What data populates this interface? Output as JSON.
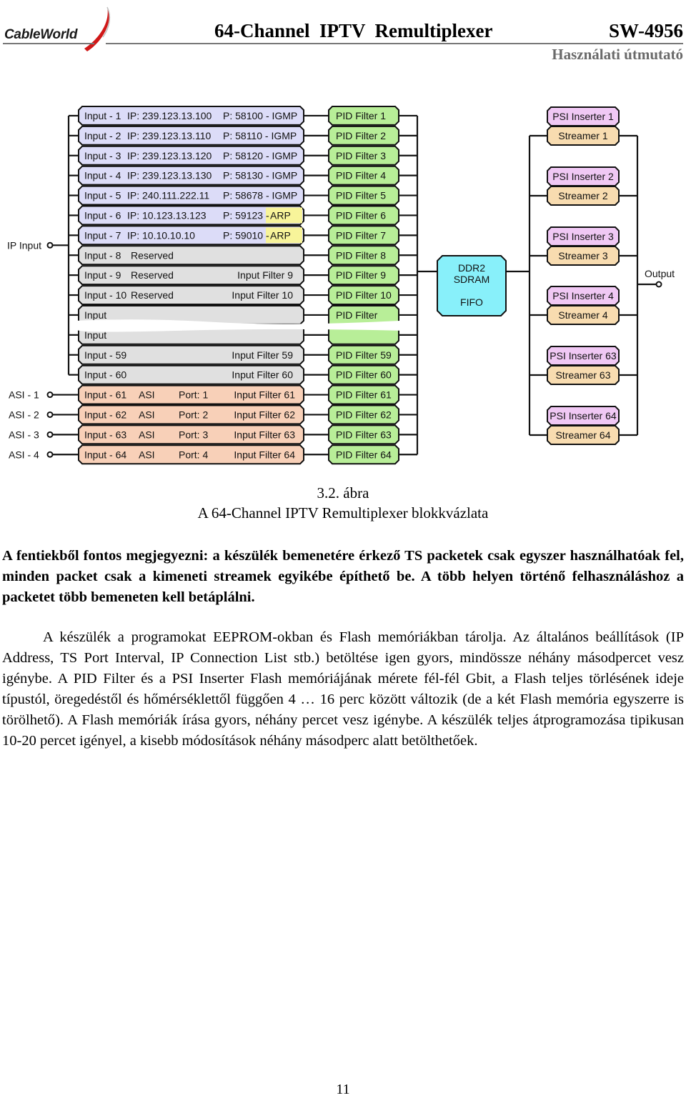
{
  "header": {
    "logo_text": "CableWorld",
    "title": "64-Channel  IPTV  Remultiplexer",
    "model": "SW-4956",
    "subtitle": "Használati útmutató"
  },
  "diagram": {
    "ip_input_label": "IP Input",
    "output_label": "Output",
    "asi_labels": [
      "ASI - 1",
      "ASI - 2",
      "ASI - 3",
      "ASI - 4"
    ],
    "inputs": [
      {
        "name": "Input - 1",
        "ip": "IP: 239.123.13.100",
        "port": "P: 58100 - IGMP",
        "type": "ip"
      },
      {
        "name": "Input - 2",
        "ip": "IP: 239.123.13.110",
        "port": "P: 58110 - IGMP",
        "type": "ip"
      },
      {
        "name": "Input - 3",
        "ip": "IP: 239.123.13.120",
        "port": "P: 58120 - IGMP",
        "type": "ip"
      },
      {
        "name": "Input - 4",
        "ip": "IP: 239.123.13.130",
        "port": "P: 58130 - IGMP",
        "type": "ip"
      },
      {
        "name": "Input - 5",
        "ip": "IP: 240.111.222.11",
        "port": "P: 58678 - IGMP",
        "type": "ip"
      },
      {
        "name": "Input - 6",
        "ip": "IP:  10.123.13.123",
        "port": "P: 59123 - ",
        "arp": "ARP",
        "type": "ip"
      },
      {
        "name": "Input - 7",
        "ip": "IP:  10.10.10.10",
        "port": "P: 59010 - ",
        "arp": "ARP",
        "type": "ip"
      },
      {
        "name": "Input - 8",
        "ip": "Reserved",
        "filter": "",
        "type": "reserved"
      },
      {
        "name": "Input - 9",
        "ip": "Reserved",
        "filter": "Input Filter  9",
        "type": "reserved"
      },
      {
        "name": "Input - 10",
        "ip": "Reserved",
        "filter": "Input Filter 10",
        "type": "reserved"
      },
      {
        "name": "Input",
        "ip": "",
        "filter": "",
        "type": "gap"
      },
      {
        "name": "Input",
        "ip": "",
        "filter": "",
        "type": "gap"
      },
      {
        "name": "Input - 59",
        "ip": "",
        "filter": "Input Filter 59",
        "type": "reserved"
      },
      {
        "name": "Input - 60",
        "ip": "",
        "filter": "Input Filter 60",
        "type": "reserved"
      },
      {
        "name": "Input - 61",
        "ip": "ASI",
        "port": "Port: 1",
        "filter": "Input Filter 61",
        "type": "asi"
      },
      {
        "name": "Input - 62",
        "ip": "ASI",
        "port": "Port: 2",
        "filter": "Input Filter 62",
        "type": "asi"
      },
      {
        "name": "Input - 63",
        "ip": "ASI",
        "port": "Port: 3",
        "filter": "Input Filter 63",
        "type": "asi"
      },
      {
        "name": "Input - 64",
        "ip": "ASI",
        "port": "Port: 4",
        "filter": "Input Filter 64",
        "type": "asi"
      }
    ],
    "pid_filters": [
      "PID Filter 1",
      "PID Filter 2",
      "PID Filter 3",
      "PID Filter 4",
      "PID Filter 5",
      "PID Filter 6",
      "PID Filter 7",
      "PID Filter 8",
      "PID Filter 9",
      "PID Filter 10",
      "PID Filter",
      "",
      "PID Filter 59",
      "PID Filter 60",
      "PID Filter 61",
      "PID Filter 62",
      "PID Filter 63",
      "PID Filter 64"
    ],
    "memory": [
      "DDR2",
      "SDRAM",
      "FIFO"
    ],
    "outputs": [
      {
        "psi": "PSI Inserter 1",
        "streamer": "Streamer 1"
      },
      {
        "psi": "PSI Inserter 2",
        "streamer": "Streamer 2"
      },
      {
        "psi": "PSI Inserter 3",
        "streamer": "Streamer 3"
      },
      {
        "psi": "PSI Inserter 4",
        "streamer": "Streamer 4"
      },
      {
        "psi": "PSI Inserter 63",
        "streamer": "Streamer 63"
      },
      {
        "psi": "PSI Inserter 64",
        "streamer": "Streamer 64"
      }
    ],
    "colors": {
      "ip_input": "#dcdcf8",
      "reserved": "#e0e0e0",
      "asi": "#f8d0b8",
      "arp": "#f8f49a",
      "pid": "#b8ee98",
      "memory": "#88f0fa",
      "psi": "#f0c8f4",
      "streamer": "#f8dcb0",
      "line": "#111111"
    }
  },
  "caption": {
    "number": "3.2. ábra",
    "title": "A 64-Channel IPTV Remultiplexer blokkvázlata"
  },
  "paragraphs": {
    "bold": "A fentiekből fontos megjegyezni: a készülék bemenetére érkező TS packetek csak egyszer használhatóak fel, minden packet csak a kimeneti streamek egyikébe építhető be. A több helyen történő felhasználáshoz a packetet több bemeneten kell betáplálni.",
    "normal": "A készülék a programokat EEPROM-okban és Flash memóriákban tárolja. Az általános beállítások (IP Address, TS Port Interval, IP Connection List stb.) betöltése igen gyors, mindössze néhány másodpercet vesz igénybe. A PID Filter és a PSI Inserter Flash memóriájának mérete fél-fél Gbit, a Flash teljes törlésének ideje típustól, öregedéstől és hőmérséklettől függően 4 … 16 perc között változik (de a két Flash memória egyszerre is törölhető). A Flash memóriák írása gyors, néhány percet vesz igénybe. A készülék teljes átprogramozása tipikusan 10-20 percet igényel, a kisebb módosítások néhány másodperc alatt betölthetőek."
  },
  "page_number": "11"
}
